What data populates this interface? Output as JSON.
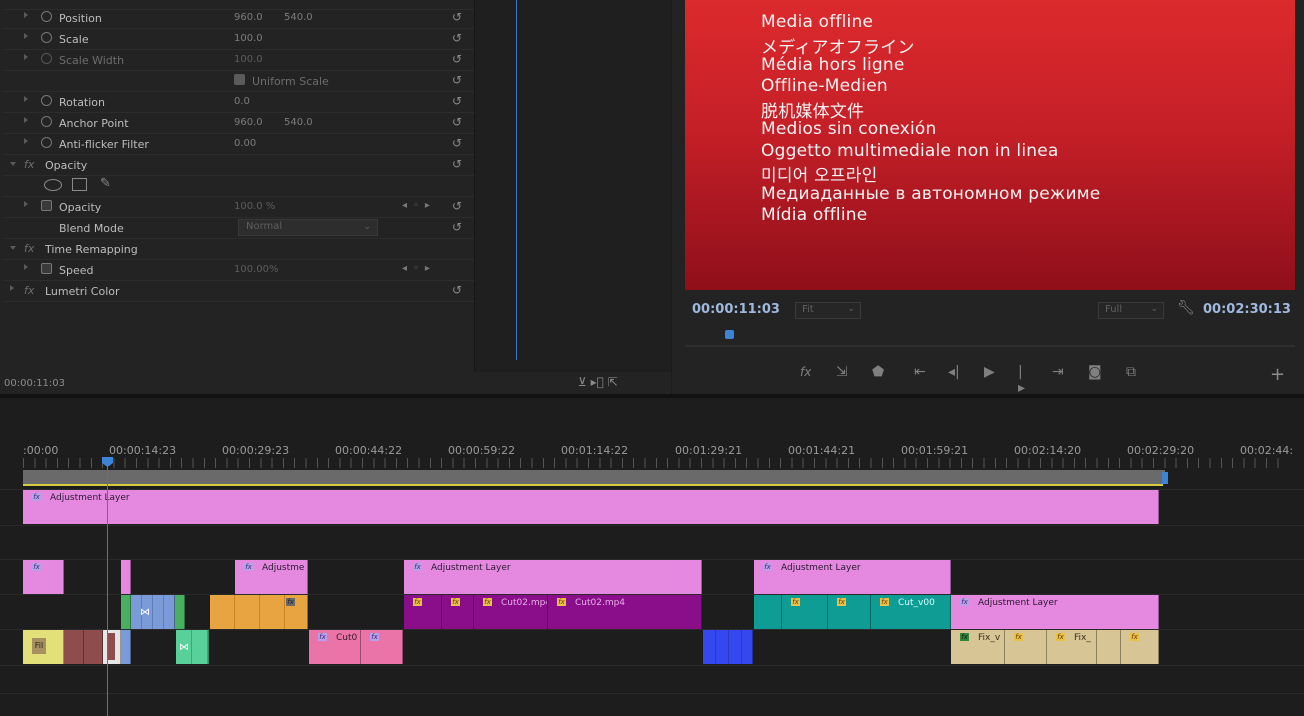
{
  "effect_controls": {
    "rows": [
      {
        "label": "Position",
        "v1": "960.0",
        "v2": "540.0"
      },
      {
        "label": "Scale",
        "v1": "100.0",
        "v2": ""
      },
      {
        "label": "Scale Width",
        "v1": "100.0",
        "v2": ""
      },
      {
        "label": "Uniform Scale",
        "v1": "",
        "v2": ""
      },
      {
        "label": "Rotation",
        "v1": "0.0",
        "v2": ""
      },
      {
        "label": "Anchor Point",
        "v1": "960.0",
        "v2": "540.0"
      },
      {
        "label": "Anti-flicker Filter",
        "v1": "0.00",
        "v2": ""
      }
    ],
    "opacity_group": "Opacity",
    "opacity_label": "Opacity",
    "opacity_value": "100.0 %",
    "blend_label": "Blend Mode",
    "blend_value": "Normal",
    "time_remap_group": "Time Remapping",
    "speed_label": "Speed",
    "speed_value": "100.00%",
    "lumetri_group": "Lumetri Color",
    "fx_glyph": "fx",
    "reset_glyph": "↺",
    "timecode": "00:00:11:03",
    "bottom_icons": "⊻ ▸⃒ ⇱"
  },
  "program_monitor": {
    "offline_lines": [
      "Media offline",
      "メディアオフライン",
      "Média hors ligne",
      "Offline-Medien",
      "脱机媒体文件",
      "Medios sin conexión",
      "Oggetto multimediale non in linea",
      "미디어 오프라인",
      "Медиаданные в автономном режиме",
      "Mídia offline"
    ],
    "current_time": "00:00:11:03",
    "duration": "00:02:30:13",
    "zoom_label": "Fit",
    "quality_label": "Full",
    "transport_icons": "fx ⇥ ♥ ⇤ ◀ ▶ ▶| ⇥ ◉ ⧉",
    "add_glyph": "+"
  },
  "timeline": {
    "ruler_labels": [
      ":00:00",
      "00:00:14:23",
      "00:00:29:23",
      "00:00:44:22",
      "00:00:59:22",
      "00:01:14:22",
      "00:01:29:21",
      "00:01:44:21",
      "00:01:59:21",
      "00:02:14:20",
      "00:02:29:20",
      "00:02:44:"
    ],
    "clip_names": {
      "adj_full": "Adjustment Layer",
      "adj_short": "Adjustme",
      "adj_mid": "Adjustment Layer",
      "adj_right": "Adjustment Layer",
      "adj_v2": "Adjustment Layer",
      "cut02a": "Cut02.mp4",
      "cut02b": "Cut02.mp4",
      "cut_v00": "Cut_v00",
      "cut0": "Cut0",
      "fix_v": "Fix_v",
      "fix_": "Fix_",
      "fil": "Fil"
    },
    "fx_glyph": "fx"
  },
  "colors": {
    "accent_blue": "#3d84d6",
    "adjustment": "#e588e0",
    "purple": "#8a0e8a",
    "teal": "#0e9c94",
    "beige": "#d8c595",
    "offline_red": "#dc2a2d"
  }
}
